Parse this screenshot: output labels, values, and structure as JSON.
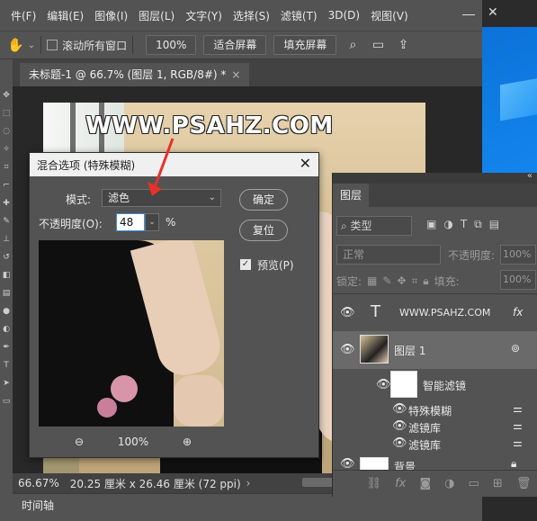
{
  "menu": [
    "件(F)",
    "编辑(E)",
    "图像(I)",
    "图层(L)",
    "文字(Y)",
    "选择(S)",
    "滤镜(T)",
    "3D(D)",
    "视图(V)"
  ],
  "options": {
    "scroll_all": "滚动所有窗口",
    "zoom": "100%",
    "fit_screen": "适合屏幕",
    "fill_screen": "填充屏幕"
  },
  "doc_tab": {
    "title": "未标题-1 @ 66.7% (图层 1, RGB/8#) *",
    "close": "×"
  },
  "watermark": "WWW.PSAHZ.COM",
  "status": {
    "zoom": "66.67%",
    "info": "20.25 厘米 x 26.46 厘米 (72 ppi)",
    "arrow": "›"
  },
  "timeline": "时间轴",
  "dialog": {
    "title": "混合选项 (特殊模糊)",
    "mode_label": "模式:",
    "mode_value": "滤色",
    "opacity_label": "不透明度(O):",
    "opacity_value": "48",
    "opacity_unit": "%",
    "ok": "确定",
    "reset": "复位",
    "preview": "预览(P)",
    "zoom_out": "⊖",
    "zoom_pct": "100%",
    "zoom_in": "⊕"
  },
  "layers_panel": {
    "tab": "图层",
    "filter_kind": "类型",
    "blend": "正常",
    "opacity_label": "不透明度:",
    "opacity_val": "100%",
    "lock_label": "锁定:",
    "fill_label": "填充:",
    "fill_val": "100%",
    "text_layer": "WWW.PSAHZ.COM",
    "layer1": "图层 1",
    "smart_filters": "智能滤镜",
    "filters": [
      "特殊模糊",
      "滤镜库",
      "滤镜库"
    ],
    "background": "背景",
    "fx": "fx"
  },
  "colors": {
    "accent": "#3b8fd8",
    "arrow_red": "#e8312a",
    "dark": "#535353"
  }
}
